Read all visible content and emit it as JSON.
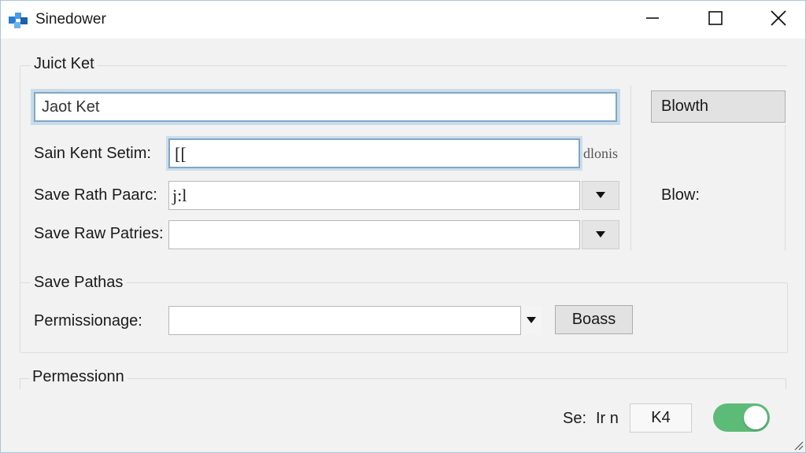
{
  "window": {
    "title": "Sinedower"
  },
  "colors": {
    "accent": "#7fa7c9",
    "toggle_on": "#5dbb78",
    "window_bg": "#f2f2f2"
  },
  "icons": {
    "app": "app-logo-icon",
    "minimize": "minimize-icon",
    "maximize": "maximize-icon",
    "close": "close-icon",
    "dropdown": "chevron-down-icon",
    "resize": "resize-grip-icon"
  },
  "group1": {
    "title": "Juict Ket",
    "top_input_value": "Jaot Ket",
    "top_button": "Blowth",
    "rows": [
      {
        "label": "Sain Kent Setim:",
        "value": "[[",
        "suffix": "dlonis"
      },
      {
        "label": "Save Rath Paarc:",
        "value": "j:l",
        "side_label": "Blow:"
      },
      {
        "label": "Save Raw Patries:",
        "value": ""
      }
    ]
  },
  "group2": {
    "title": "Save Pathas",
    "row_label": "Permissionage:",
    "row_value": "",
    "button": "Boass"
  },
  "group3": {
    "title": "Permessionn"
  },
  "footer": {
    "label1": "Se:",
    "label2": "Ir n",
    "button": "K4",
    "toggle_on": true
  }
}
